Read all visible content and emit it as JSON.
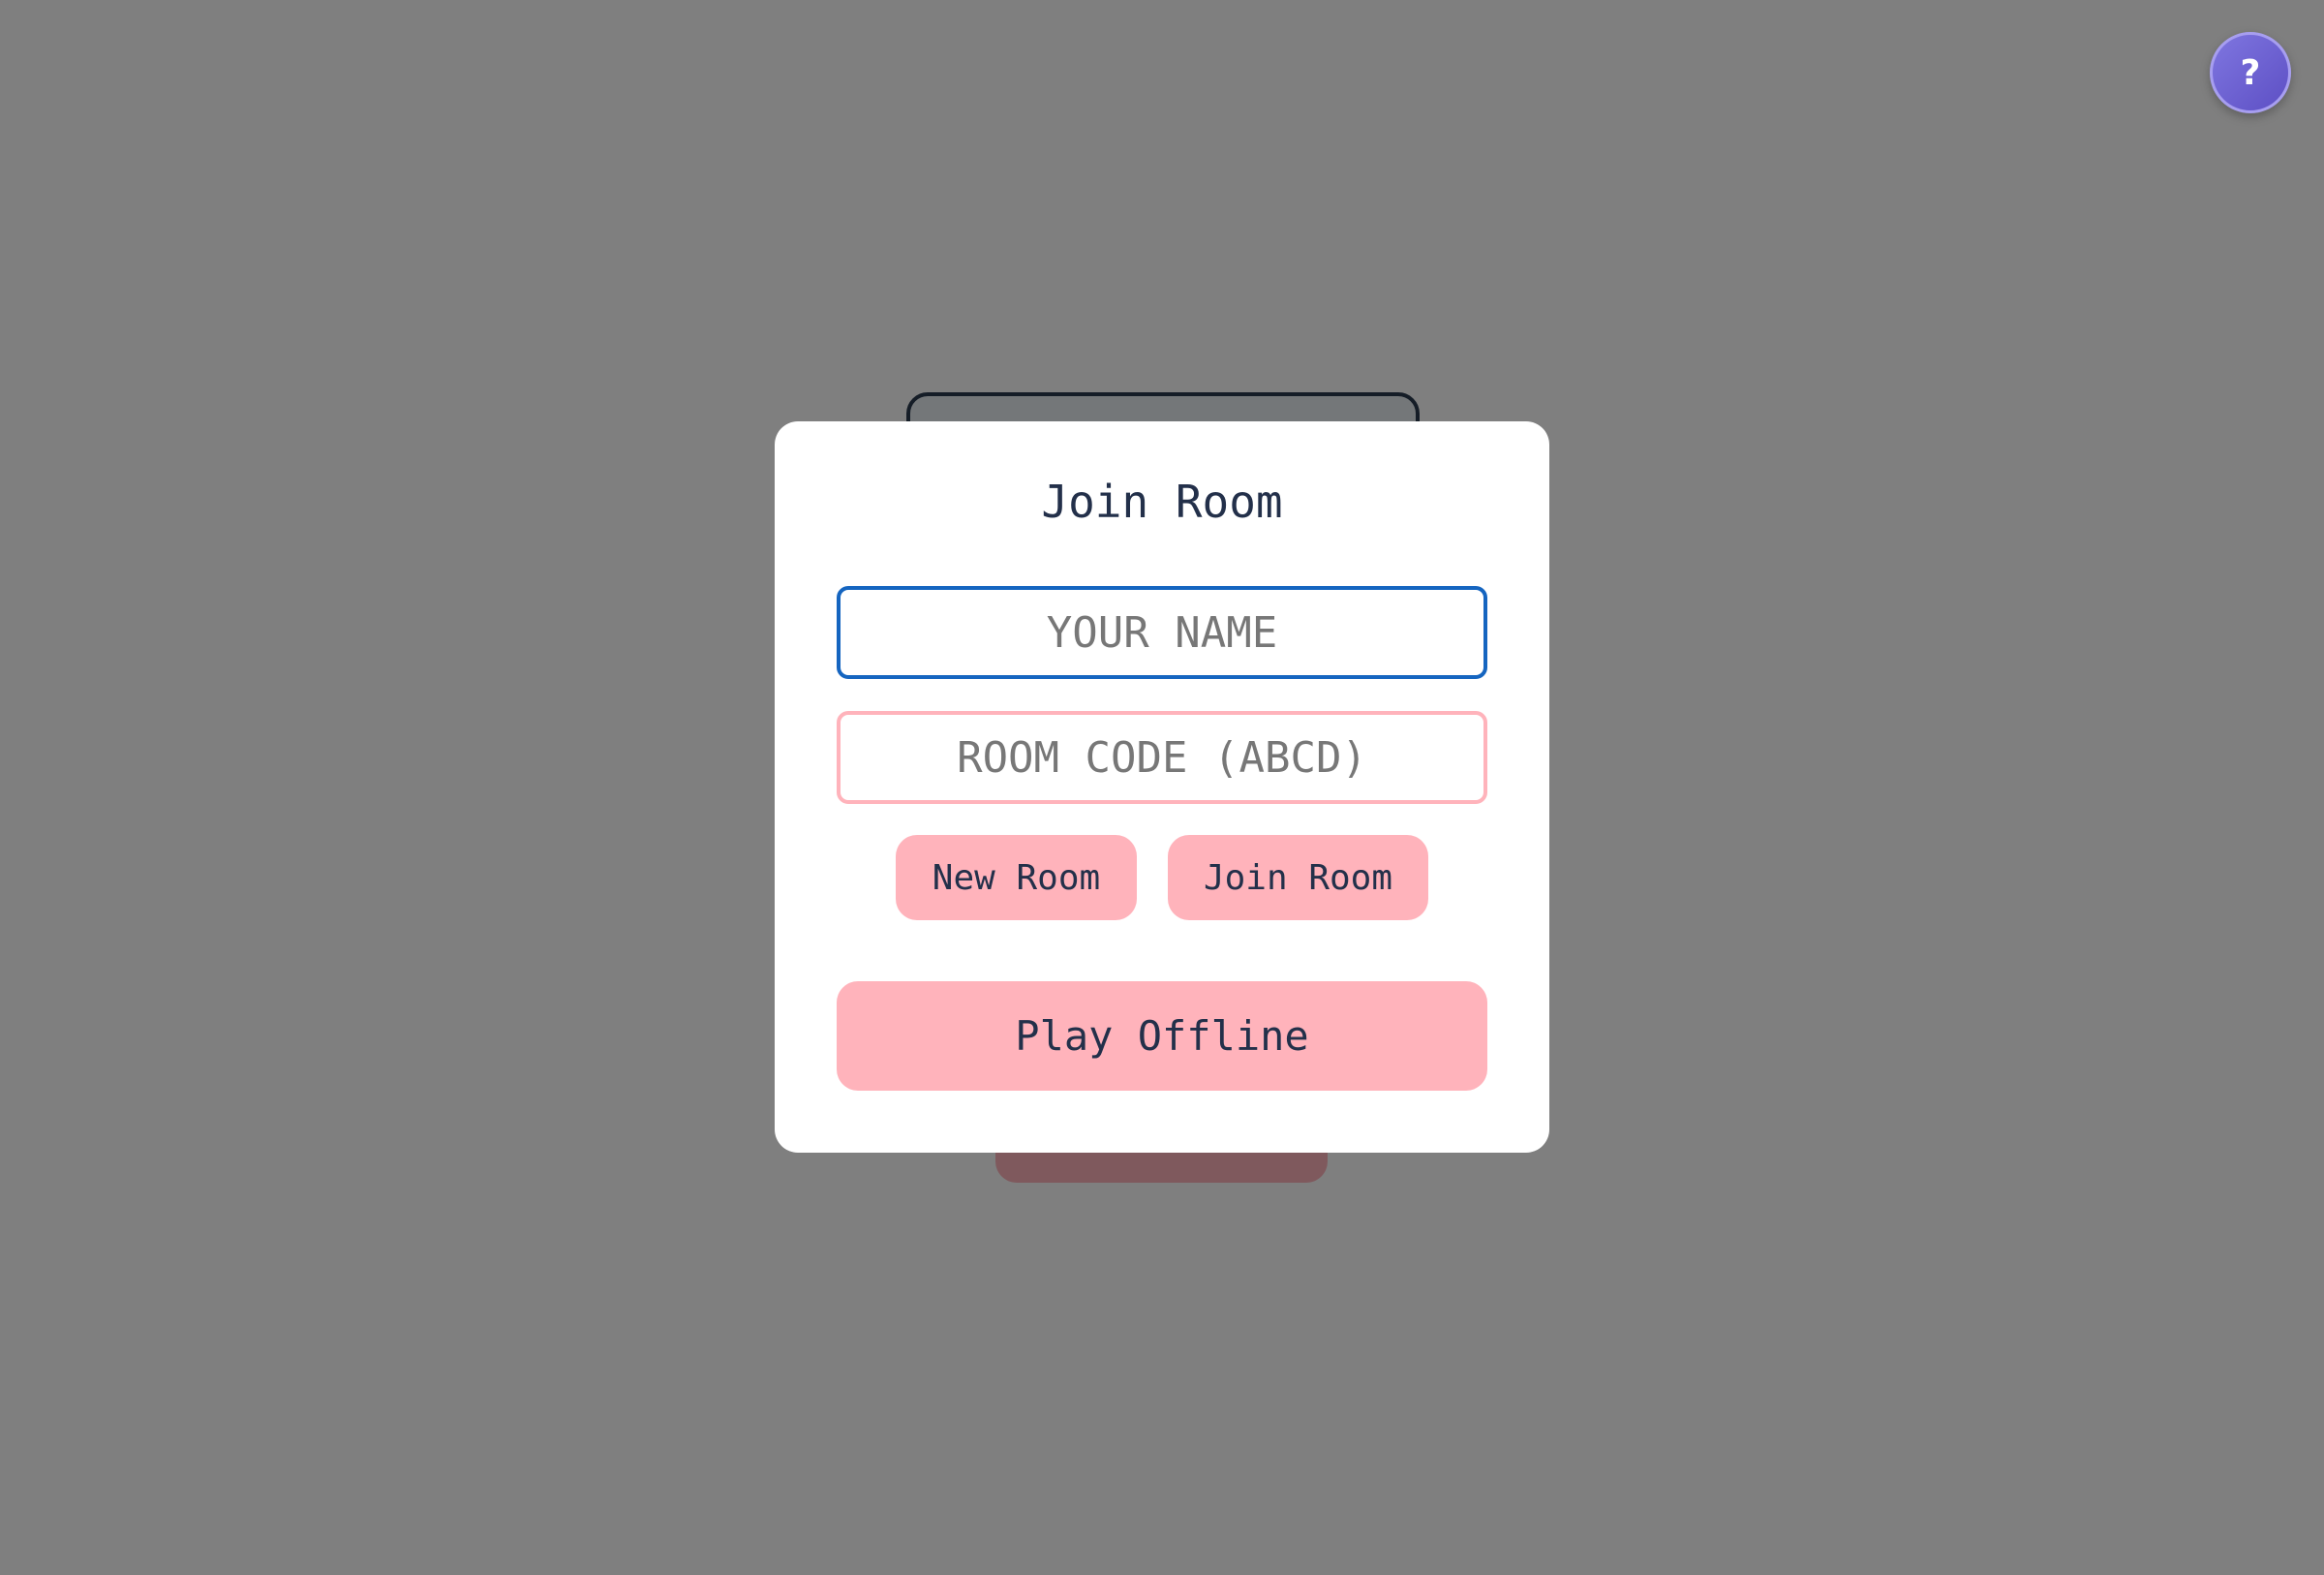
{
  "help": {
    "label": "?",
    "icon": "help-icon"
  },
  "modal": {
    "title": "Join Room",
    "name_input": {
      "value": "",
      "placeholder": "YOUR NAME"
    },
    "room_code_input": {
      "value": "",
      "placeholder": "ROOM CODE (ABCD)"
    },
    "new_room_label": "New Room",
    "join_room_label": "Join Room",
    "play_offline_label": "Play Offline"
  },
  "colors": {
    "overlay": "#808080",
    "accent_pink": "#ffb3bb",
    "focus_blue": "#1565c0",
    "text_dark": "#23304a",
    "help_purple": "#6a5fd0"
  }
}
